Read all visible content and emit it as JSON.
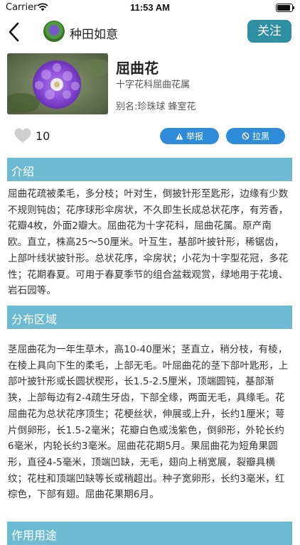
{
  "status_bar": {
    "carrier": "Carrier",
    "time": "11:53 AM"
  },
  "nav": {
    "app_name": "种田如意",
    "follow_label": "关注"
  },
  "plant": {
    "name": "屈曲花",
    "family": "十字花科屈曲花属",
    "alias": "别名:珍珠球  蜂室花"
  },
  "actions": {
    "like_count": "10",
    "report_label": "举报",
    "block_label": "拉黑"
  },
  "sections": [
    {
      "title": "介绍",
      "text": "屈曲花疏被柔毛，多分枝；叶对生，倒披针形至匙形，边缘有少数不规则钝齿；花序球形伞房状，不久即生长成总状花序，有芳香，花瓣4枚，外面2瓣大。屈曲花为十字花科，屈曲花属。原产南欧。直立，株高25～50厘米。叶互生，基部叶披针形，稀锯齿，上部叶线状披针形。总状花序，伞房状；小花为十字型花冠，多花性；花期春夏。可用于春夏季节的组合盆栽观赏，绿地用于花境、岩石园等。"
    },
    {
      "title": "分布区域",
      "text": "茎屈曲花为一年生草木，高10-40厘米；茎直立，稍分枝，有棱，在棱上具向下生的柔毛，上部无毛。叶屈曲花的茎下部叶匙形，上部叶披针形或长圆状楔形，长1.5-2.5厘米，顶端圆钝，基部渐狭，上部每边有2-4疏生牙齿，下部全缘，两面无毛，具缘毛。花屈曲花为总状花序顶生；花梗丝状，伸展或上升，长约1厘米；萼片倒卵形，长1.5-2毫米；花瓣白色或浅紫色，倒卵形，外轮长约6毫米，内轮长约3毫米。屈曲花花期5月。果屈曲花为短角果圆形，直径4-5毫米，顶端凹缺，无毛，翅向上稍宽展，裂瓣具横纹；花柱和顶端凹缺等长或稍超出。种子宽卵形，长约3毫米，红棕色，下部有翅。屈曲花果期6月。"
    },
    {
      "title": "作用用途"
    }
  ],
  "colors": {
    "accent": "#2f8fa3",
    "section_header": "#6fbad3",
    "pill": "#2d8bd8"
  }
}
